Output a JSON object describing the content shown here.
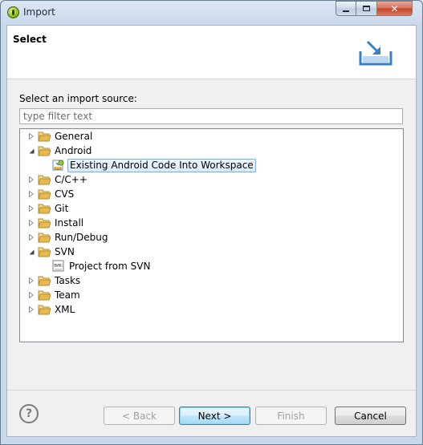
{
  "window": {
    "title": "Import"
  },
  "header": {
    "title": "Select"
  },
  "source": {
    "label": "Select an import source:",
    "filter_placeholder": "type filter text",
    "filter_value": ""
  },
  "tree": {
    "items": [
      {
        "label": "General",
        "expanded": false
      },
      {
        "label": "Android",
        "expanded": true
      },
      {
        "label": "Existing Android Code Into Workspace",
        "child": true,
        "selected": true,
        "icon": "android-project-icon"
      },
      {
        "label": "C/C++",
        "expanded": false
      },
      {
        "label": "CVS",
        "expanded": false
      },
      {
        "label": "Git",
        "expanded": false
      },
      {
        "label": "Install",
        "expanded": false
      },
      {
        "label": "Run/Debug",
        "expanded": false
      },
      {
        "label": "SVN",
        "expanded": true
      },
      {
        "label": "Project from SVN",
        "child": true,
        "icon": "svn-project-icon"
      },
      {
        "label": "Tasks",
        "expanded": false
      },
      {
        "label": "Team",
        "expanded": false
      },
      {
        "label": "XML",
        "expanded": false
      }
    ]
  },
  "buttons": {
    "back": "< Back",
    "next": "Next >",
    "finish": "Finish",
    "cancel": "Cancel"
  },
  "icons": {
    "help": "?",
    "close": "✕"
  },
  "colors": {
    "folder": "#e9b94d",
    "selection_border": "#84acdd",
    "close_button": "#c0442b"
  }
}
